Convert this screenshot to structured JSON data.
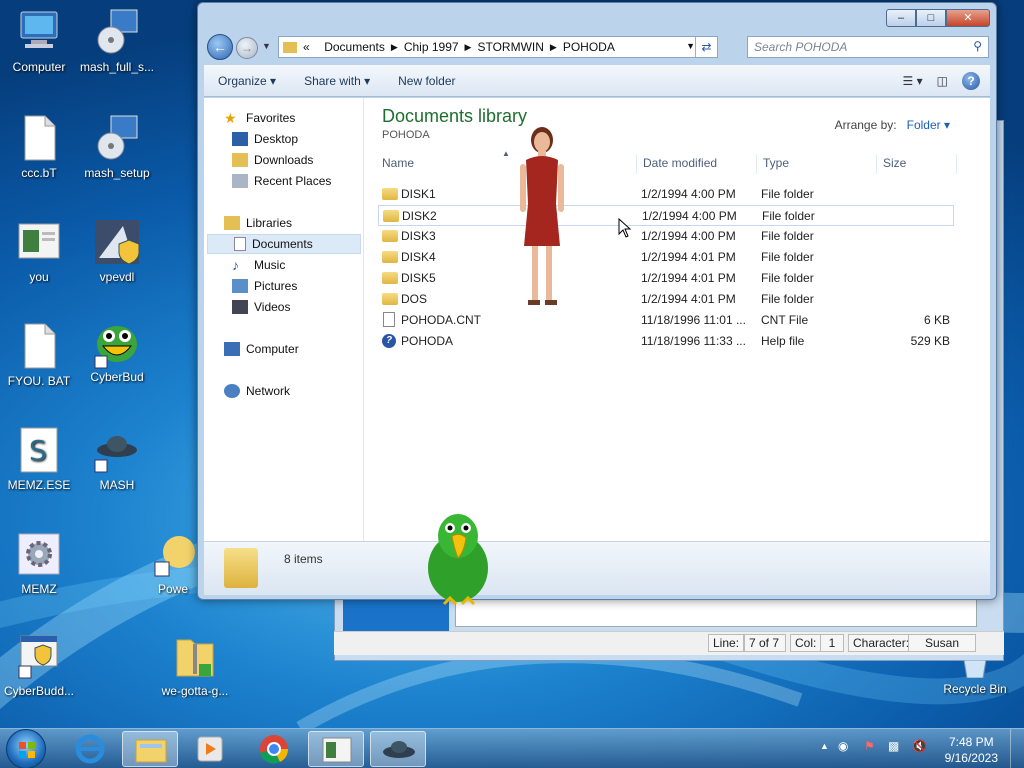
{
  "desktop": {
    "icons": [
      {
        "label": "Computer"
      },
      {
        "label": "mash_full_s..."
      },
      {
        "label": "ccc.bT"
      },
      {
        "label": "mash_setup"
      },
      {
        "label": "you"
      },
      {
        "label": "vpevdl"
      },
      {
        "label": "FYOU. BAT"
      },
      {
        "label": "CyberBud"
      },
      {
        "label": "MEMZ.ESE"
      },
      {
        "label": "MASH"
      },
      {
        "label": "MEMZ"
      },
      {
        "label": "Powe"
      },
      {
        "label": "CyberBudd..."
      },
      {
        "label": "we-gotta-g..."
      },
      {
        "label": "Recycle Bin"
      }
    ]
  },
  "explorer": {
    "title_buttons": {
      "minimize": "–",
      "maximize": "□",
      "close": "✕"
    },
    "breadcrumb": [
      "Documents",
      "Chip 1997",
      "STORMWIN",
      "POHODA"
    ],
    "breadcrumb_overflow": "«",
    "search_placeholder": "Search POHODA",
    "toolbar": {
      "organize": "Organize ▾",
      "share": "Share with ▾",
      "new_folder": "New folder"
    },
    "nav": {
      "favorites": "Favorites",
      "desktop": "Desktop",
      "downloads": "Downloads",
      "recent": "Recent Places",
      "libraries": "Libraries",
      "documents": "Documents",
      "music": "Music",
      "pictures": "Pictures",
      "videos": "Videos",
      "computer": "Computer",
      "network": "Network"
    },
    "library_title": "Documents library",
    "library_sub": "POHODA",
    "arrange_label": "Arrange by:",
    "arrange_value": "Folder ▾",
    "columns": {
      "name": "Name",
      "date": "Date modified",
      "type": "Type",
      "size": "Size"
    },
    "rows": [
      {
        "name": "DISK1",
        "date": "1/2/1994 4:00 PM",
        "type": "File folder",
        "size": ""
      },
      {
        "name": "DISK2",
        "date": "1/2/1994 4:00 PM",
        "type": "File folder",
        "size": ""
      },
      {
        "name": "DISK3",
        "date": "1/2/1994 4:00 PM",
        "type": "File folder",
        "size": ""
      },
      {
        "name": "DISK4",
        "date": "1/2/1994 4:01 PM",
        "type": "File folder",
        "size": ""
      },
      {
        "name": "DISK5",
        "date": "1/2/1994 4:01 PM",
        "type": "File folder",
        "size": ""
      },
      {
        "name": "DOS",
        "date": "1/2/1994 4:01 PM",
        "type": "File folder",
        "size": ""
      },
      {
        "name": "POHODA.CNT",
        "date": "11/18/1996 11:01 ...",
        "type": "CNT File",
        "size": "6 KB"
      },
      {
        "name": "POHODA",
        "date": "11/18/1996 11:33 ...",
        "type": "Help file",
        "size": "529 KB"
      }
    ],
    "items_count": "8 items"
  },
  "background_window": {
    "status": {
      "line_label": "Line:",
      "line_value": "7 of 7",
      "col_label": "Col:",
      "col_value": "1",
      "char_label": "Character:",
      "char_value": "Susan"
    }
  },
  "taskbar": {
    "time": "7:48 PM",
    "date": "9/16/2023"
  }
}
